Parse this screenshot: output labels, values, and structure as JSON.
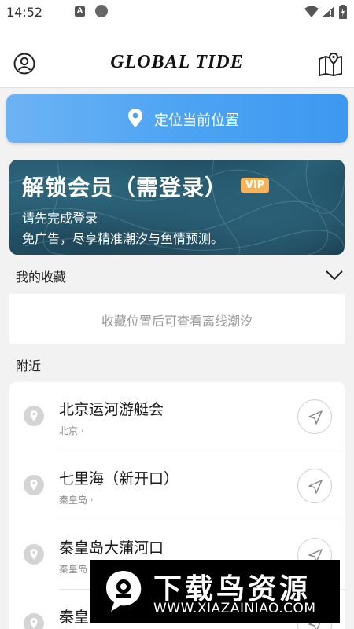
{
  "status_bar": {
    "time": "14:52",
    "a_icon_letter": "A"
  },
  "app_bar": {
    "brand": "GLOBAL  TIDE",
    "profile_icon": "user-circle-icon",
    "map_icon": "map-pin-icon"
  },
  "locate": {
    "label": "定位当前位置",
    "icon": "location-pin-icon"
  },
  "vip": {
    "title": "解锁会员（需登录）",
    "badge": "VIP",
    "line1": "请先完成登录",
    "line2": "免广告，尽享精准潮汐与鱼情预测。"
  },
  "favorites": {
    "header": "我的收藏",
    "empty_message": "收藏位置后可查看离线潮汐"
  },
  "nearby": {
    "header": "附近",
    "items": [
      {
        "name": "北京运河游艇会",
        "region": "北京 ·"
      },
      {
        "name": "七里海（新开口）",
        "region": "秦皇岛 ·"
      },
      {
        "name": "秦皇岛大蒲河口",
        "region": "秦皇岛 ·"
      },
      {
        "name": "秦皇",
        "region": ""
      }
    ]
  },
  "watermark": {
    "title": "下载鸟资源",
    "url": "WWW.XIAZAINIAO.COM"
  },
  "colors": {
    "accent": "#4ea4f3",
    "vip_badge": "#f5b35b",
    "background": "#f2f2f2"
  }
}
